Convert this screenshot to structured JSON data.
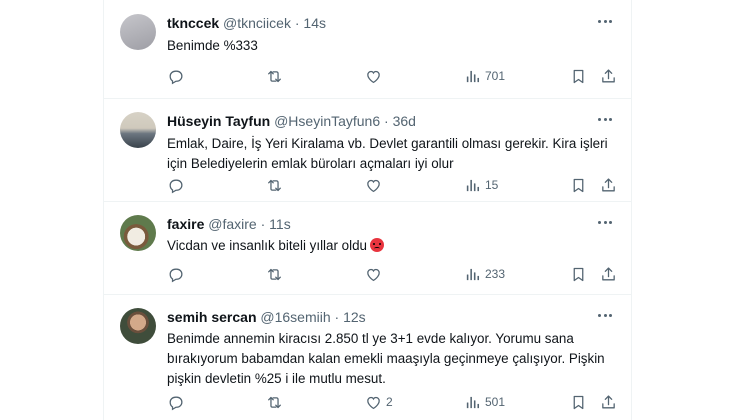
{
  "tweets": [
    {
      "name": "tknccek",
      "handle": "@tknciicek",
      "time": "14s",
      "text_lines": [
        "Benimde %333"
      ],
      "emoji": "",
      "likes": "",
      "views": "701",
      "avatar_colors": [
        "#bfbfc4",
        "#a3a3aa"
      ]
    },
    {
      "name": "Hüseyin Tayfun",
      "handle": "@HseyinTayfun6",
      "time": "36d",
      "text_lines": [
        "Emlak, Daire, İş Yeri Kiralama vb. Devlet garantili olması gerekir. Kira işleri",
        "için Belediyelerin emlak büroları açmaları iyi olur"
      ],
      "emoji": "",
      "likes": "",
      "views": "15",
      "avatar_colors": [
        "#c9c4b8",
        "#4a5560"
      ]
    },
    {
      "name": "faxire",
      "handle": "@faxire",
      "time": "11s",
      "text_lines": [
        "Vicdan ve insanlık biteli yıllar oldu"
      ],
      "emoji": "angry-face",
      "likes": "",
      "views": "233",
      "avatar_colors": [
        "#6b7f56",
        "#c8bfae"
      ]
    },
    {
      "name": "semih sercan",
      "handle": "@16semiih",
      "time": "12s",
      "text_lines": [
        "Benimde annemin kiracısı 2.850 tl ye 3+1 evde kalıyor. Yorumu sana",
        "bırakıyorum babamdan kalan emekli maaşıyla geçinmeye çalışıyor. Pişkin",
        "pişkin devletin %25 i ile mutlu mesut."
      ],
      "emoji": "",
      "likes": "2",
      "views": "501",
      "avatar_colors": [
        "#8a6d55",
        "#3d4a3a"
      ]
    }
  ],
  "icons": [
    "reply-icon",
    "retweet-icon",
    "like-icon",
    "views-icon",
    "bookmark-icon",
    "more-icon"
  ],
  "colors": {
    "text": "#0f1419",
    "secondary": "#536471",
    "border": "#eff3f4",
    "background": "#ffffff"
  }
}
